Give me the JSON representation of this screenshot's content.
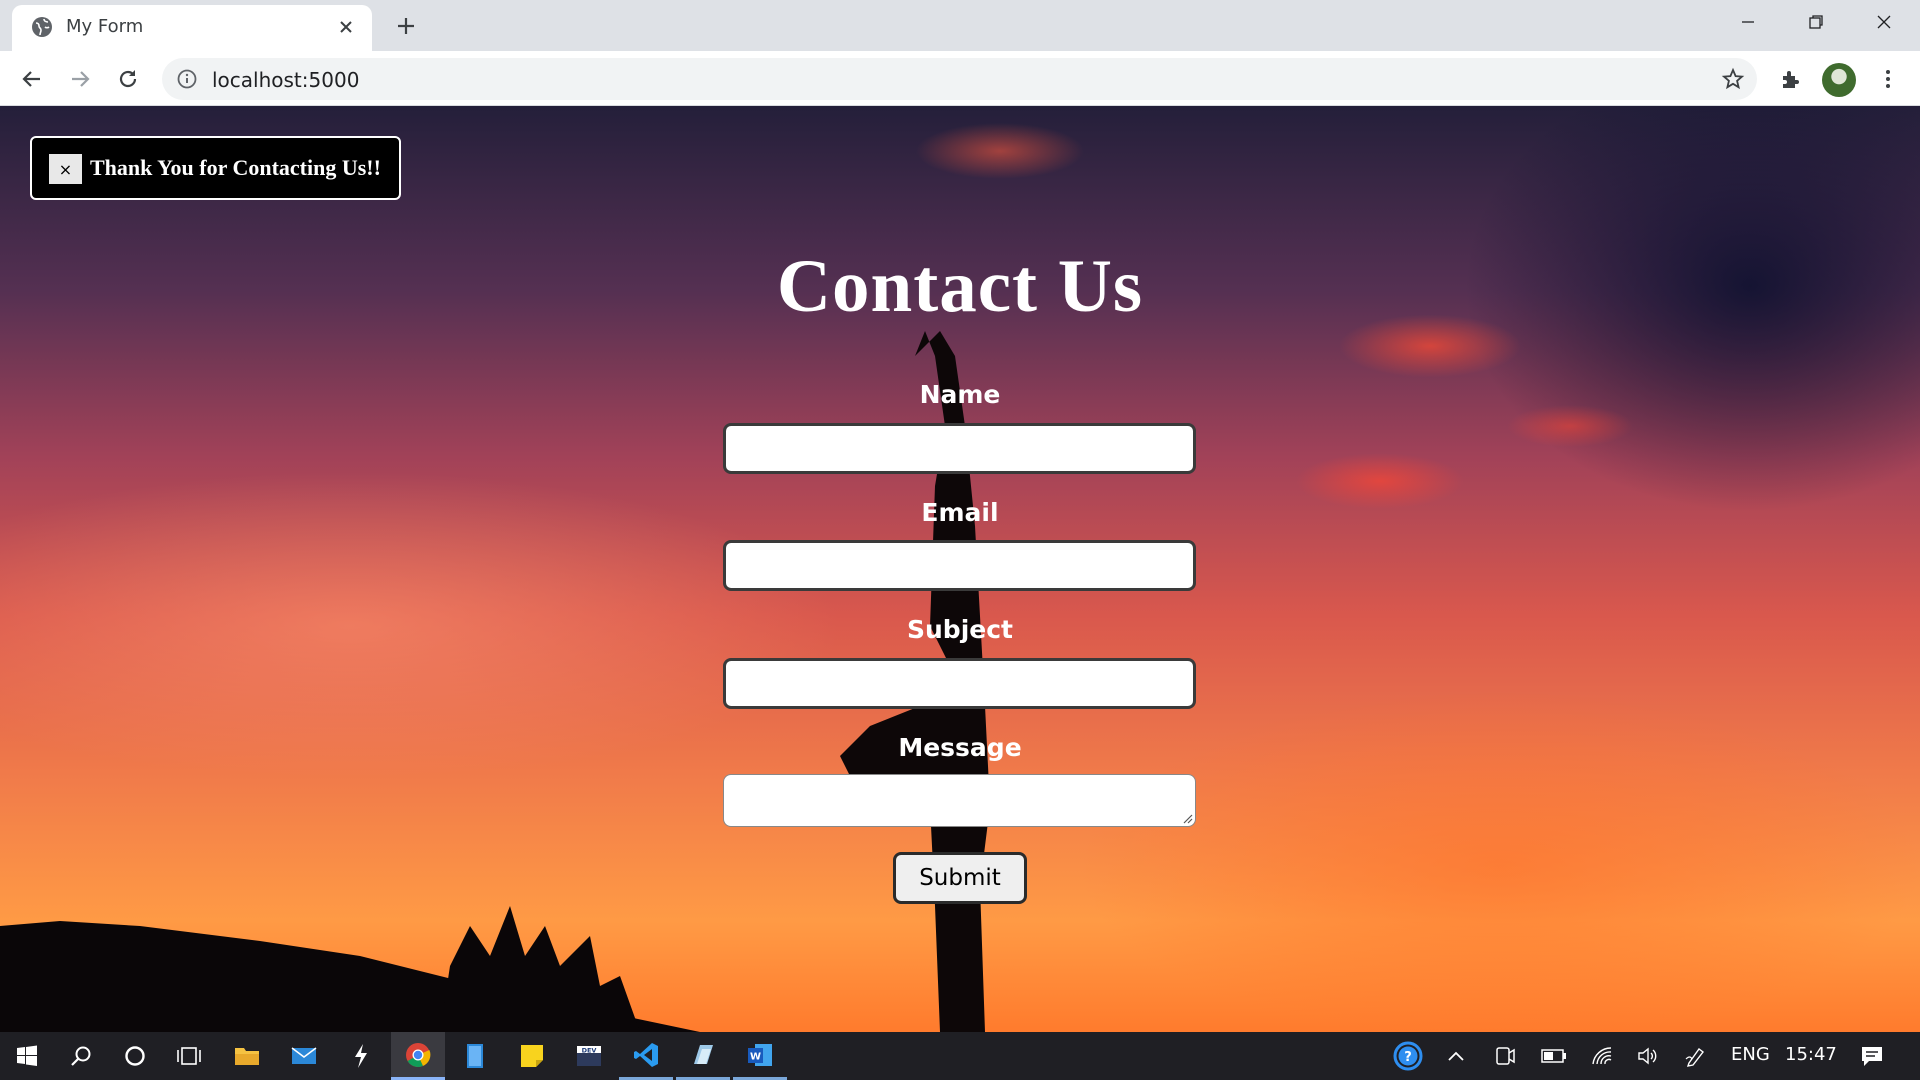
{
  "browser": {
    "tab_title": "My Form",
    "url": "localhost:5000"
  },
  "toast": {
    "close_label": "×",
    "message": "Thank You for Contacting Us!!"
  },
  "form": {
    "heading": "Contact Us",
    "fields": [
      {
        "label": "Name"
      },
      {
        "label": "Email"
      },
      {
        "label": "Subject"
      },
      {
        "label": "Message"
      }
    ],
    "submit_label": "Submit"
  },
  "taskbar": {
    "language": "ENG",
    "time": "15:47",
    "apps": [
      "start-icon",
      "search-icon",
      "cortana-icon",
      "task-view-icon",
      "file-explorer-icon",
      "mail-icon",
      "app-bolt-icon",
      "chrome-icon",
      "notepad-icon",
      "sticky-notes-icon",
      "dev-app-icon",
      "vscode-icon",
      "app-paper-icon",
      "word-icon"
    ]
  }
}
